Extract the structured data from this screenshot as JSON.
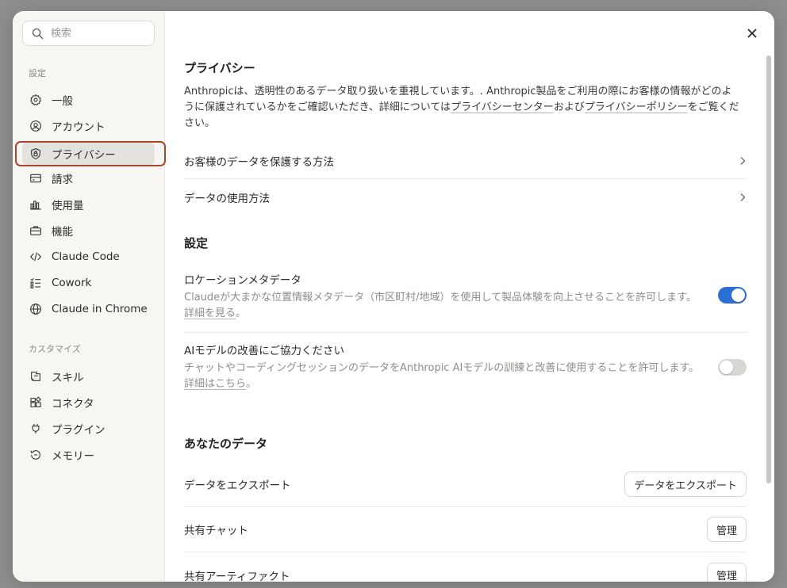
{
  "sidebar": {
    "search_placeholder": "検索",
    "section_settings": "設定",
    "section_customize": "カスタマイズ",
    "items": [
      {
        "label": "一般",
        "icon": "gear-icon"
      },
      {
        "label": "アカウント",
        "icon": "user-circle-icon"
      },
      {
        "label": "プライバシー",
        "icon": "shield-lock-icon",
        "active": true
      },
      {
        "label": "請求",
        "icon": "credit-card-icon"
      },
      {
        "label": "使用量",
        "icon": "bar-chart-icon"
      },
      {
        "label": "機能",
        "icon": "briefcase-icon"
      },
      {
        "label": "Claude Code",
        "icon": "code-icon"
      },
      {
        "label": "Cowork",
        "icon": "checklist-icon"
      },
      {
        "label": "Claude in Chrome",
        "icon": "globe-icon"
      }
    ],
    "customize_items": [
      {
        "label": "スキル",
        "icon": "skill-icon"
      },
      {
        "label": "コネクタ",
        "icon": "connector-icon"
      },
      {
        "label": "プラグイン",
        "icon": "plug-icon"
      },
      {
        "label": "メモリー",
        "icon": "memory-icon"
      }
    ]
  },
  "privacy": {
    "title": "プライバシー",
    "desc_1": "Anthropicは、透明性のあるデータ取り扱いを重視しています。. Anthropic製品をご利用の際にお客様の情報がどのように保護されているかをご確認いただき、詳細については",
    "desc_link_1": "プライバシーセンター",
    "desc_2": "および",
    "desc_link_2": "プライバシーポリシー",
    "desc_3": "をご覧ください。",
    "links": [
      {
        "label": "お客様のデータを保護する方法"
      },
      {
        "label": "データの使用方法"
      }
    ]
  },
  "settings": {
    "title": "設定",
    "location": {
      "title": "ロケーションメタデータ",
      "desc": "Claudeが大まかな位置情報メタデータ（市区町村/地域）を使用して製品体験を向上させることを許可します。",
      "link": "詳細を見る",
      "suffix": "。",
      "enabled": true
    },
    "ai_improve": {
      "title": "AIモデルの改善にご協力ください",
      "desc": "チャットやコーディングセッションのデータをAnthropic AIモデルの訓練と改善に使用することを許可します。",
      "link": "詳細はこちら",
      "suffix": "。",
      "enabled": false
    }
  },
  "your_data": {
    "title": "あなたのデータ",
    "rows": [
      {
        "label": "データをエクスポート",
        "button": "データをエクスポート"
      },
      {
        "label": "共有チャット",
        "button": "管理"
      },
      {
        "label": "共有アーティファクト",
        "button": "管理"
      }
    ]
  },
  "colors": {
    "accent": "#2c6fd4",
    "highlight": "#a8452c"
  }
}
